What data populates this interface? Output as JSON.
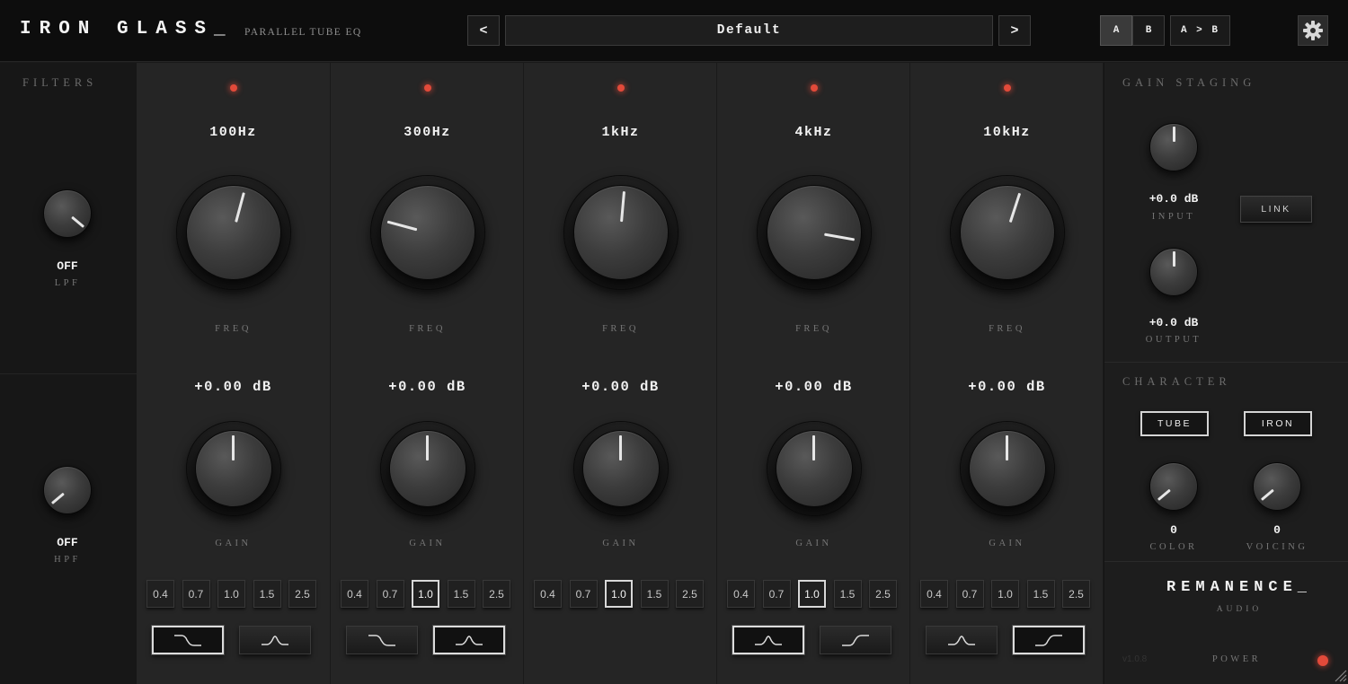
{
  "header": {
    "logo": "IRON GLASS_",
    "subtitle": "PARALLEL TUBE EQ",
    "prev_label": "<",
    "preset_name": "Default",
    "next_label": ">",
    "ab_a": "A",
    "ab_b": "B",
    "ab_copy": "A > B",
    "settings_icon": "gear-icon"
  },
  "filters": {
    "title": "FILTERS",
    "lpf": {
      "value": "OFF",
      "label": "LPF"
    },
    "hpf": {
      "value": "OFF",
      "label": "HPF"
    }
  },
  "bands": [
    {
      "freq_value": "100Hz",
      "freq_label": "FREQ",
      "gain_value": "+0.00 dB",
      "gain_label": "GAIN",
      "q_options": [
        "0.4",
        "0.7",
        "1.0",
        "1.5",
        "2.5"
      ],
      "q_selected": null,
      "shapes": [
        {
          "icon": "low-shelf-icon",
          "selected": true
        },
        {
          "icon": "bell-icon",
          "selected": false
        }
      ]
    },
    {
      "freq_value": "300Hz",
      "freq_label": "FREQ",
      "gain_value": "+0.00 dB",
      "gain_label": "GAIN",
      "q_options": [
        "0.4",
        "0.7",
        "1.0",
        "1.5",
        "2.5"
      ],
      "q_selected": "1.0",
      "shapes": [
        {
          "icon": "low-shelf-icon",
          "selected": false
        },
        {
          "icon": "bell-icon",
          "selected": true
        }
      ]
    },
    {
      "freq_value": "1kHz",
      "freq_label": "FREQ",
      "gain_value": "+0.00 dB",
      "gain_label": "GAIN",
      "q_options": [
        "0.4",
        "0.7",
        "1.0",
        "1.5",
        "2.5"
      ],
      "q_selected": "1.0",
      "shapes": []
    },
    {
      "freq_value": "4kHz",
      "freq_label": "FREQ",
      "gain_value": "+0.00 dB",
      "gain_label": "GAIN",
      "q_options": [
        "0.4",
        "0.7",
        "1.0",
        "1.5",
        "2.5"
      ],
      "q_selected": "1.0",
      "shapes": [
        {
          "icon": "bell-icon",
          "selected": true
        },
        {
          "icon": "high-shelf-icon",
          "selected": false
        }
      ]
    },
    {
      "freq_value": "10kHz",
      "freq_label": "FREQ",
      "gain_value": "+0.00 dB",
      "gain_label": "GAIN",
      "q_options": [
        "0.4",
        "0.7",
        "1.0",
        "1.5",
        "2.5"
      ],
      "q_selected": null,
      "shapes": [
        {
          "icon": "bell-icon",
          "selected": false
        },
        {
          "icon": "high-shelf-icon",
          "selected": true
        }
      ]
    }
  ],
  "gain_staging": {
    "title": "GAIN STAGING",
    "input_value": "+0.0 dB",
    "input_label": "INPUT",
    "link_label": "LINK",
    "output_value": "+0.0 dB",
    "output_label": "OUTPUT"
  },
  "character": {
    "title": "CHARACTER",
    "tube_label": "TUBE",
    "iron_label": "IRON",
    "color_value": "0",
    "color_label": "COLOR",
    "voicing_value": "0",
    "voicing_label": "VOICING"
  },
  "brand": {
    "name": "REMANENCE_",
    "sub": "AUDIO",
    "version": "v1.0.8",
    "power_label": "POWER"
  },
  "colors": {
    "led": "#e24a3a",
    "panel_bg": "#252525",
    "topbar_bg": "#0d0d0d",
    "text": "#f2f2f2"
  }
}
